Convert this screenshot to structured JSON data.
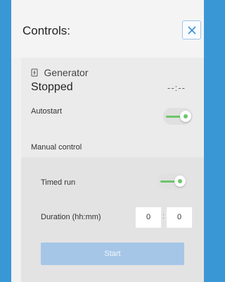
{
  "header": {
    "title": "Controls:"
  },
  "generator": {
    "label": "Generator",
    "status": "Stopped",
    "runtime": "--:--"
  },
  "autostart": {
    "label": "Autostart",
    "enabled": true
  },
  "manual_control": {
    "label": "Manual control",
    "timed_run": {
      "label": "Timed run",
      "enabled": true
    },
    "duration": {
      "label": "Duration (hh:mm)",
      "hours": "0",
      "minutes": "0",
      "separator": ":"
    },
    "start_label": "Start"
  },
  "colors": {
    "background": "#3a97d6",
    "toggle_on": "#6cc66a",
    "start_button_disabled": "#a6c6e8"
  }
}
